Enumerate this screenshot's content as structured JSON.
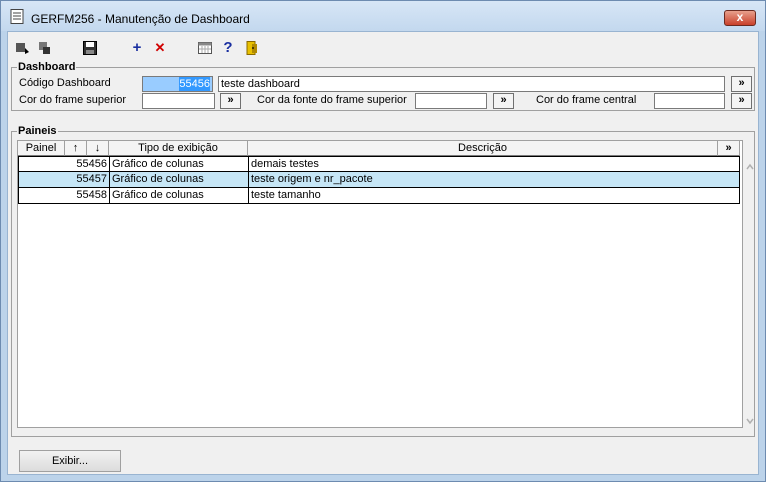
{
  "window": {
    "title": "GERFM256 - Manutenção de Dashboard",
    "close_label": "x"
  },
  "toolbar": {
    "icons": [
      "first-record-icon",
      "previous-record-icon",
      "save-icon",
      "add-icon",
      "delete-icon",
      "calendar-grid-icon",
      "help-icon",
      "exit-icon"
    ],
    "help_label": "?",
    "add_label": "+",
    "delete_label": "✕"
  },
  "dashboard": {
    "group_label": "Dashboard",
    "codigo_label": "Código Dashboard",
    "codigo_value": "55456",
    "nome_value": "teste dashboard",
    "cor_frame_superior_label": "Cor do frame superior",
    "cor_frame_superior_value": "",
    "cor_fonte_label": "Cor da fonte do frame superior",
    "cor_fonte_value": "",
    "cor_frame_central_label": "Cor do frame central",
    "cor_frame_central_value": "",
    "more_label": "»"
  },
  "paineis": {
    "group_label": "Paineis",
    "columns": {
      "painel": "Painel",
      "up": "↑",
      "down": "↓",
      "tipo": "Tipo de exibição",
      "descricao": "Descrição",
      "more": "»"
    },
    "rows": [
      {
        "painel": "55456",
        "tipo": "Gráfico de colunas",
        "descricao": "demais testes"
      },
      {
        "painel": "55457",
        "tipo": "Gráfico de colunas",
        "descricao": "teste origem e nr_pacote"
      },
      {
        "painel": "55458",
        "tipo": "Gráfico de colunas",
        "descricao": "teste tamanho"
      }
    ],
    "highlight_color": "#c6e6f6"
  },
  "footer": {
    "exibir_label": "Exibir..."
  }
}
